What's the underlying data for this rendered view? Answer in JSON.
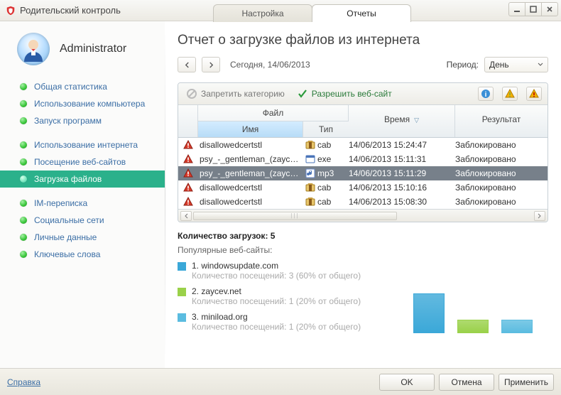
{
  "window": {
    "title": "Родительский контроль",
    "tab_settings": "Настройка",
    "tab_reports": "Отчеты"
  },
  "user": {
    "name": "Administrator"
  },
  "nav": {
    "items": [
      "Общая статистика",
      "Использование компьютера",
      "Запуск программ",
      "Использование интернета",
      "Посещение веб-сайтов",
      "Загрузка файлов",
      "IM-переписка",
      "Социальные сети",
      "Личные данные",
      "Ключевые слова"
    ],
    "active_index": 5,
    "gaps_after": [
      2,
      5
    ]
  },
  "page": {
    "title": "Отчет о загрузке файлов из интернета",
    "date_label": "Сегодня, 14/06/2013",
    "period_label": "Период:",
    "period_value": "День"
  },
  "toolbar": {
    "deny": "Запретить категорию",
    "allow": "Разрешить веб-сайт"
  },
  "grid": {
    "head": {
      "file": "Файл",
      "name": "Имя",
      "type": "Тип",
      "time": "Время",
      "result": "Результат"
    },
    "rows": [
      {
        "name": "disallowedcertstl",
        "ft": "cab",
        "time": "14/06/2013 15:24:47",
        "res": "Заблокировано",
        "sel": false
      },
      {
        "name": "psy_-_gentleman_(zaycev…",
        "ft": "exe",
        "time": "14/06/2013 15:11:31",
        "res": "Заблокировано",
        "sel": false
      },
      {
        "name": "psy_-_gentleman_(zaycev…",
        "ft": "mp3",
        "time": "14/06/2013 15:11:29",
        "res": "Заблокировано",
        "sel": true
      },
      {
        "name": "disallowedcertstl",
        "ft": "cab",
        "time": "14/06/2013 15:10:16",
        "res": "Заблокировано",
        "sel": false
      },
      {
        "name": "disallowedcertstl",
        "ft": "cab",
        "time": "14/06/2013 15:08:30",
        "res": "Заблокировано",
        "sel": false
      }
    ]
  },
  "stats": {
    "title": "Количество загрузок: 5",
    "subtitle": "Популярные веб-сайты:",
    "sites": [
      {
        "n": "1.",
        "domain": "windowsupdate.com",
        "meta": "Количество посещений: 3 (60% от общего)",
        "color": "#3ba8d8"
      },
      {
        "n": "2.",
        "domain": "zaycev.net",
        "meta": "Количество посещений: 1 (20% от общего)",
        "color": "#9ad14a"
      },
      {
        "n": "3.",
        "domain": "miniload.org",
        "meta": "Количество посещений: 1 (20% от общего)",
        "color": "#5bbce0"
      }
    ]
  },
  "chart_data": {
    "type": "bar",
    "categories": [
      "windowsupdate.com",
      "zaycev.net",
      "miniload.org"
    ],
    "values": [
      3,
      1,
      1
    ],
    "colors": [
      "#3ba8d8",
      "#9ad14a",
      "#5bbce0"
    ],
    "title": "",
    "xlabel": "",
    "ylabel": "",
    "ylim": [
      0,
      3
    ]
  },
  "footer": {
    "help": "Справка",
    "ok": "OK",
    "cancel": "Отмена",
    "apply": "Применить"
  }
}
